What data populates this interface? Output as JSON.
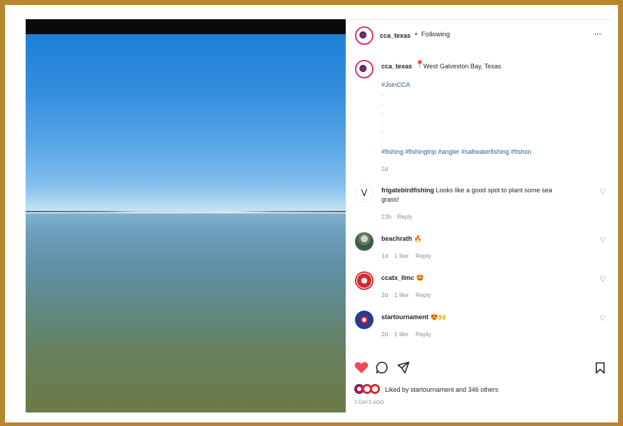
{
  "header": {
    "username": "cca_texas",
    "separator": "•",
    "follow_state": "Following",
    "more": "···"
  },
  "caption": {
    "username": "cca_texas",
    "location_icon": "pin-icon",
    "location": "West Galveston Bay, Texas",
    "tag_join": "#JoinCCA",
    "dots": [
      ".",
      ".",
      ".",
      ".",
      ".",
      "."
    ],
    "hashtags": "#fishing #fishingtrip #angler #saltwaterfishing #fishon",
    "time": "2d"
  },
  "comments": [
    {
      "username": "frigatebirdfishing",
      "text": "Looks like a good spot to plant some sea",
      "text2": "grass!",
      "time": "23h",
      "likes": "",
      "reply": "Reply"
    },
    {
      "username": "beachrath",
      "emoji": "🔥",
      "time": "1d",
      "likes": "1 like",
      "reply": "Reply"
    },
    {
      "username": "ccatx_llmc",
      "emoji": "🤩",
      "time": "2d",
      "likes": "1 like",
      "reply": "Reply"
    },
    {
      "username": "startournament",
      "emoji": "😍🙌",
      "time": "2d",
      "likes": "1 like",
      "reply": "Reply"
    }
  ],
  "actions": {
    "liked_by_prefix": "Liked by",
    "liked_by_user": "startournament",
    "liked_by_suffix": "and 346 others",
    "date": "2 DAYS AGO"
  },
  "colors": {
    "frame": "#b8862d",
    "heart": "#ed4956",
    "link": "#305d99"
  }
}
